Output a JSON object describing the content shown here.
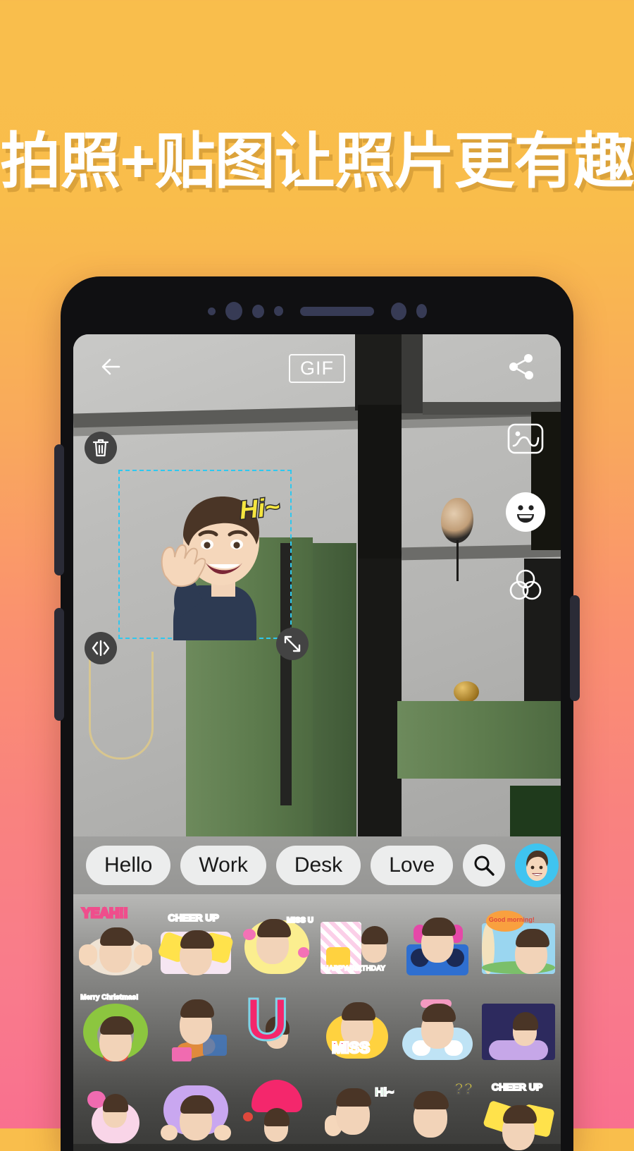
{
  "promo": {
    "headline": "拍照+贴图让照片更有趣",
    "background_top_color": "#F9BE4C",
    "background_bottom_color": "#F9708F",
    "headline_color": "#FFFFFF"
  },
  "device": {
    "frame_color": "#101012",
    "buttons": [
      "volume-rocker",
      "assistant-key",
      "power-key"
    ]
  },
  "app": {
    "topbar": {
      "back_icon": "arrow-left-icon",
      "gif_label": "GIF",
      "share_icon": "share-icon"
    },
    "tools": [
      {
        "name": "photo-background-tool",
        "icon": "image-wave-icon"
      },
      {
        "name": "sticker-tool",
        "icon": "smiley-icon",
        "active": true
      },
      {
        "name": "filter-tool",
        "icon": "three-circles-icon"
      }
    ],
    "selection": {
      "delete_icon": "trash-icon",
      "flip_icon": "flip-horizontal-icon",
      "resize_icon": "resize-diagonal-icon",
      "border_color": "#2EC8EF",
      "sticker_caption": "Hi~"
    },
    "chips": [
      {
        "label": "Hello"
      },
      {
        "label": "Work"
      },
      {
        "label": "Desk"
      },
      {
        "label": "Love"
      }
    ],
    "chip_actions": {
      "search_icon": "search-icon",
      "avatar_icon": "avatar-icon",
      "avatar_bg": "#3FC4F0"
    },
    "sticker_grid": [
      {
        "caption": "YEAH!!",
        "accent": "#F6E23C",
        "bg": "#EF4E8C"
      },
      {
        "caption": "CHEER UP",
        "accent": "#FFE24B",
        "bg": "#F05A7E"
      },
      {
        "caption": "MISS U",
        "accent": "#FBEE8F",
        "bg": "#F472B6"
      },
      {
        "caption": "HAPPY BIRTHDAY",
        "accent": "#FFD23F",
        "bg": "#FBCFE8"
      },
      {
        "caption": "",
        "accent": "#2F6FD0",
        "bg": "#E548A8"
      },
      {
        "caption": "Good morning!",
        "accent": "#F9A03F",
        "bg": "#9AD6F0"
      },
      {
        "caption": "Merry Christmas!",
        "accent": "#8CC63F",
        "bg": "#E74C3C"
      },
      {
        "caption": "",
        "accent": "#E08A3C",
        "bg": "#3B3B6B"
      },
      {
        "caption": "U",
        "accent": "#F4276C",
        "bg": "#F4276C"
      },
      {
        "caption": "MISS",
        "accent": "#F4276C",
        "bg": "#FFD23F"
      },
      {
        "caption": "",
        "accent": "#F49AC1",
        "bg": "#BFE3F5"
      },
      {
        "caption": "",
        "accent": "#C6A7E8",
        "bg": "#2D2A5E"
      },
      {
        "caption": "",
        "accent": "#F06BB0",
        "bg": "#F9D5E8"
      },
      {
        "caption": "",
        "accent": "#B18AE0",
        "bg": "#C9A7F0"
      },
      {
        "caption": "",
        "accent": "#F4276C",
        "bg": "#F4276C"
      },
      {
        "caption": "Hi~",
        "accent": "#6FD08C",
        "bg": "#EFEFEF"
      },
      {
        "caption": "??",
        "accent": "#F6E23C",
        "bg": "#EFEFEF"
      },
      {
        "caption": "CHEER UP",
        "accent": "#FFE24B",
        "bg": "#F05A7E"
      }
    ]
  }
}
